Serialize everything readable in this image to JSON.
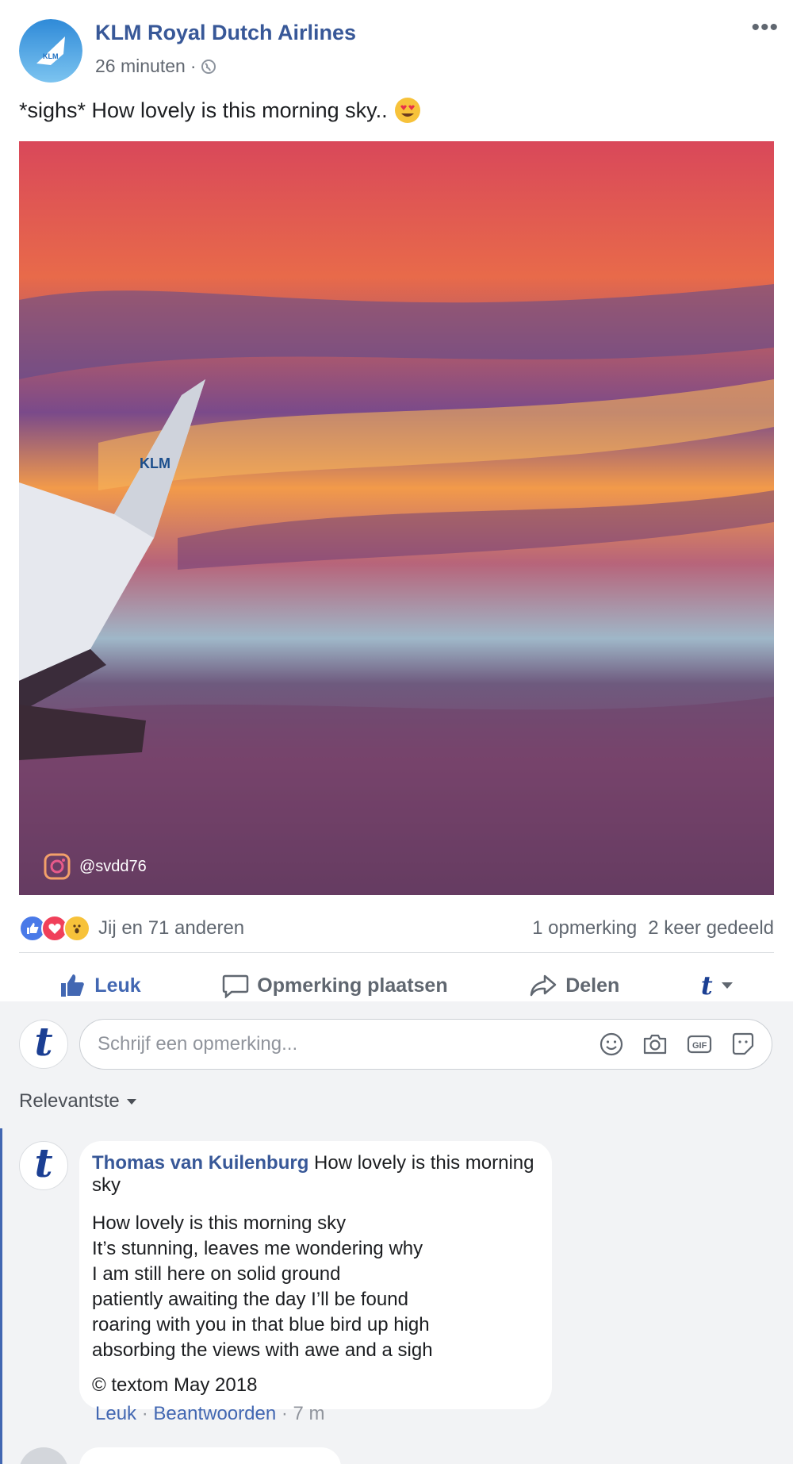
{
  "post": {
    "page_name": "KLM Royal Dutch Airlines",
    "time": "26 minuten",
    "time_sep": "·",
    "caption": "*sighs* How lovely is this morning sky..",
    "photo_credit": "@svdd76",
    "photo_logo_text": "KLM"
  },
  "stats": {
    "reactions": "Jij en 71 anderen",
    "comments": "1 opmerking",
    "shares": "2 keer gedeeld"
  },
  "actions": {
    "like": "Leuk",
    "comment": "Opmerking plaatsen",
    "share": "Delen"
  },
  "composer": {
    "placeholder": "Schrijf een opmerking..."
  },
  "sort": {
    "label": "Relevantste"
  },
  "comment": {
    "author": "Thomas van Kuilenburg",
    "title": "How lovely is this morning sky",
    "lines": [
      "How lovely is this morning sky",
      "It’s stunning, leaves me wondering why",
      "I am still here on solid ground",
      "patiently awaiting the day I’ll be found",
      "roaring with you in that blue bird up high",
      "absorbing the views with awe and a sigh"
    ],
    "copyright": "© textom May 2018",
    "like": "Leuk",
    "reply": "Beantwoorden",
    "time": "7 m",
    "sep": "·"
  },
  "colors": {
    "link": "#385898",
    "accent": "#4267b2",
    "muted": "#606770",
    "comments_bg": "#f2f3f5"
  }
}
